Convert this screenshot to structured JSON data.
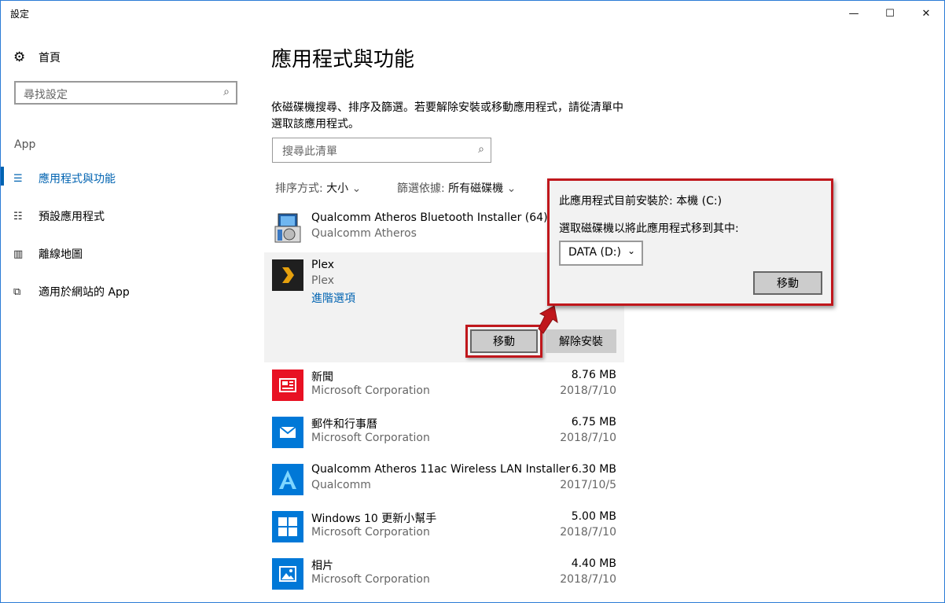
{
  "window": {
    "title": "設定",
    "minimize": "—",
    "maximize": "☐",
    "close": "✕"
  },
  "sidebar": {
    "home": "首頁",
    "search_placeholder": "尋找設定",
    "section": "App",
    "items": [
      {
        "label": "應用程式與功能",
        "icon": "apps-list-icon"
      },
      {
        "label": "預設應用程式",
        "icon": "default-apps-icon"
      },
      {
        "label": "離線地圖",
        "icon": "map-icon"
      },
      {
        "label": "適用於網站的 App",
        "icon": "website-app-icon"
      }
    ]
  },
  "main": {
    "title": "應用程式與功能",
    "description": "依磁碟機搜尋、排序及篩選。若要解除安裝或移動應用程式，請從清單中選取該應用程式。",
    "list_search_placeholder": "搜尋此清單",
    "sort_label": "排序方式:",
    "sort_value": "大小",
    "filter_label": "篩選依據:",
    "filter_value": "所有磁碟機",
    "apps": [
      {
        "name": "Qualcomm Atheros Bluetooth Installer (64)",
        "publisher": "Qualcomm Atheros",
        "size": "",
        "date": ""
      },
      {
        "name": "Plex",
        "publisher": "Plex",
        "advanced": "進階選項",
        "move": "移動",
        "uninstall": "解除安裝"
      },
      {
        "name": "新聞",
        "publisher": "Microsoft Corporation",
        "size": "8.76 MB",
        "date": "2018/7/10"
      },
      {
        "name": "郵件和行事曆",
        "publisher": "Microsoft Corporation",
        "size": "6.75 MB",
        "date": "2018/7/10"
      },
      {
        "name": "Qualcomm Atheros 11ac Wireless LAN Installer",
        "publisher": "Qualcomm",
        "size": "6.30 MB",
        "date": "2017/10/5"
      },
      {
        "name": "Windows 10 更新小幫手",
        "publisher": "Microsoft Corporation",
        "size": "5.00 MB",
        "date": "2018/7/10"
      },
      {
        "name": "相片",
        "publisher": "Microsoft Corporation",
        "size": "4.40 MB",
        "date": "2018/7/10"
      }
    ]
  },
  "flyout": {
    "installed_on": "此應用程式目前安裝於: 本機 (C:)",
    "choose_drive": "選取磁碟機以將此應用程式移到其中:",
    "drive_value": "DATA (D:)",
    "move": "移動"
  },
  "colors": {
    "accent": "#0063b1",
    "highlight": "#c0171c"
  }
}
